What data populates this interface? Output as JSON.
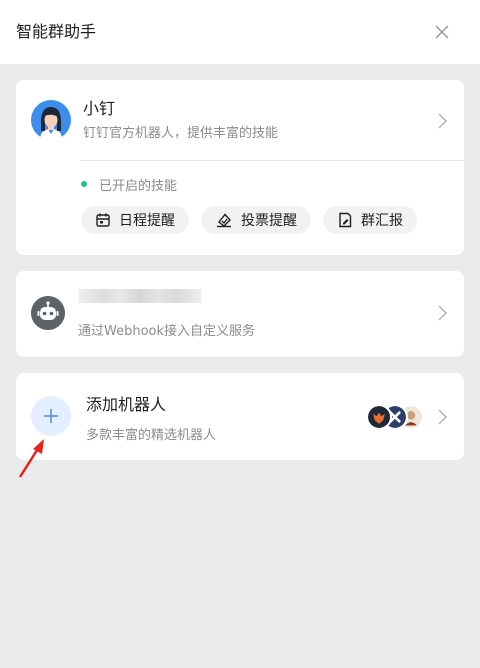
{
  "header": {
    "title": "智能群助手"
  },
  "xiaoding": {
    "name": "小钉",
    "description": "钉钉官方机器人，提供丰富的技能",
    "enabled_label": "已开启的技能",
    "skills": [
      {
        "label": "日程提醒",
        "icon": "calendar-icon"
      },
      {
        "label": "投票提醒",
        "icon": "vote-icon"
      },
      {
        "label": "群汇报",
        "icon": "report-icon"
      }
    ]
  },
  "webhook_bot": {
    "description": "通过Webhook接入自定义服务"
  },
  "add_robot": {
    "title": "添加机器人",
    "description": "多款丰富的精选机器人"
  },
  "colors": {
    "accent": "#2dbd83",
    "add_bg": "#e3efff",
    "add_plus": "#4a90e2",
    "annotation_arrow": "#e8221b"
  }
}
